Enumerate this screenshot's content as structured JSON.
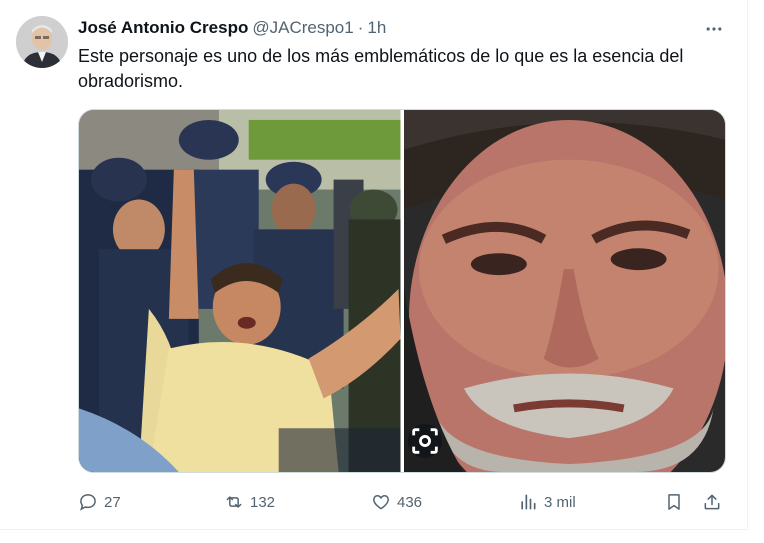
{
  "author": {
    "name": "José Antonio Crespo",
    "handle": "@JACrespo1",
    "separator": "·",
    "time": "1h"
  },
  "tweet": {
    "text": "Este personaje es uno de los más emblemáticos de lo que es la esencia del obradorismo."
  },
  "media": {
    "photos": [
      {
        "icon": "photo-police-arrest"
      },
      {
        "icon": "photo-portrait-closeup"
      }
    ],
    "alt_badge_icon": "image-scan-icon"
  },
  "actions": {
    "replies": "27",
    "reposts": "132",
    "likes": "436",
    "views": "3 mil"
  },
  "colors": {
    "text": "#0f1419",
    "secondary": "#536471",
    "border": "#cfd9de"
  }
}
